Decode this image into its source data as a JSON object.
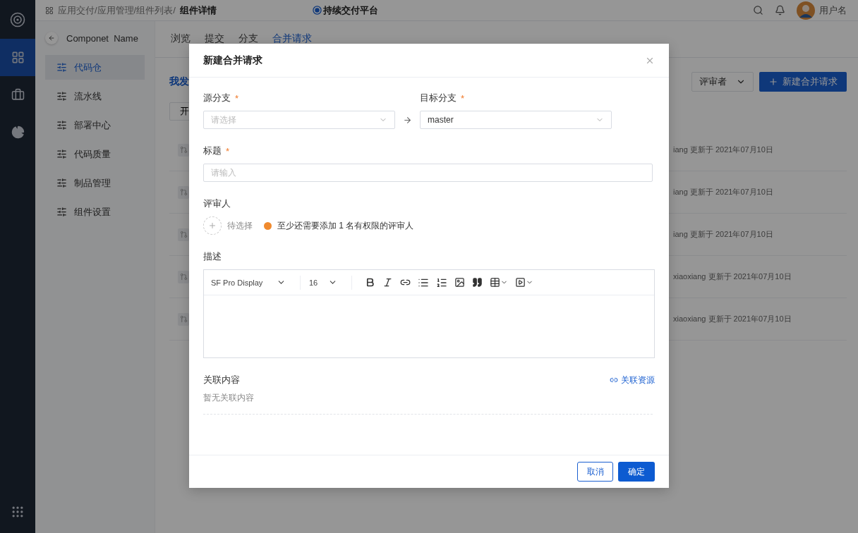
{
  "rail": {
    "items": [
      {
        "kind": "apps",
        "selected": true
      },
      {
        "kind": "briefcase",
        "selected": false
      },
      {
        "kind": "chart",
        "selected": false
      }
    ]
  },
  "header": {
    "path": "应用交付/应用管理/组件列表/",
    "current": "组件详情",
    "platform": "持续交付平台",
    "user": "用户名"
  },
  "component": {
    "name": "Componet  Name"
  },
  "nav": [
    {
      "label": "代码仓",
      "selected": true
    },
    {
      "label": "流水线",
      "selected": false
    },
    {
      "label": "部署中心",
      "selected": false
    },
    {
      "label": "代码质量",
      "selected": false
    },
    {
      "label": "制品管理",
      "selected": false
    },
    {
      "label": "组件设置",
      "selected": false
    }
  ],
  "tabs": [
    {
      "label": "浏览",
      "selected": false
    },
    {
      "label": "提交",
      "selected": false
    },
    {
      "label": "分支",
      "selected": false
    },
    {
      "label": "合并请求",
      "selected": true
    }
  ],
  "section_title": "我发",
  "filter_button": "开",
  "reviewer_filter": "评审者",
  "new_button": "新建合并请求",
  "rows": [
    {
      "meta": "iang 更新于 2021年07月10日"
    },
    {
      "meta": "iang 更新于 2021年07月10日"
    },
    {
      "meta": "iang 更新于 2021年07月10日"
    },
    {
      "meta": "xiaoxiang 更新于 2021年07月10日"
    },
    {
      "meta": "xiaoxiang 更新于 2021年07月10日"
    }
  ],
  "dialog": {
    "title": "新建合并请求",
    "source": {
      "label": "源分支",
      "mark": "*",
      "placeholder": "请选择"
    },
    "target": {
      "label": "目标分支",
      "mark": "*",
      "value": "master"
    },
    "title_field": {
      "label": "标题",
      "mark": "*",
      "placeholder": "请输入"
    },
    "reviewers": {
      "label": "评审人",
      "add": "待选择",
      "warning": "至少还需要添加 1 名有权限的评审人"
    },
    "description": {
      "label": "描述",
      "font": "SF Pro Display",
      "size": "16"
    },
    "related": {
      "label": "关联内容",
      "link": "关联资源",
      "empty": "暂无关联内容"
    },
    "buttons": {
      "cancel": "取消",
      "ok": "确定"
    }
  }
}
